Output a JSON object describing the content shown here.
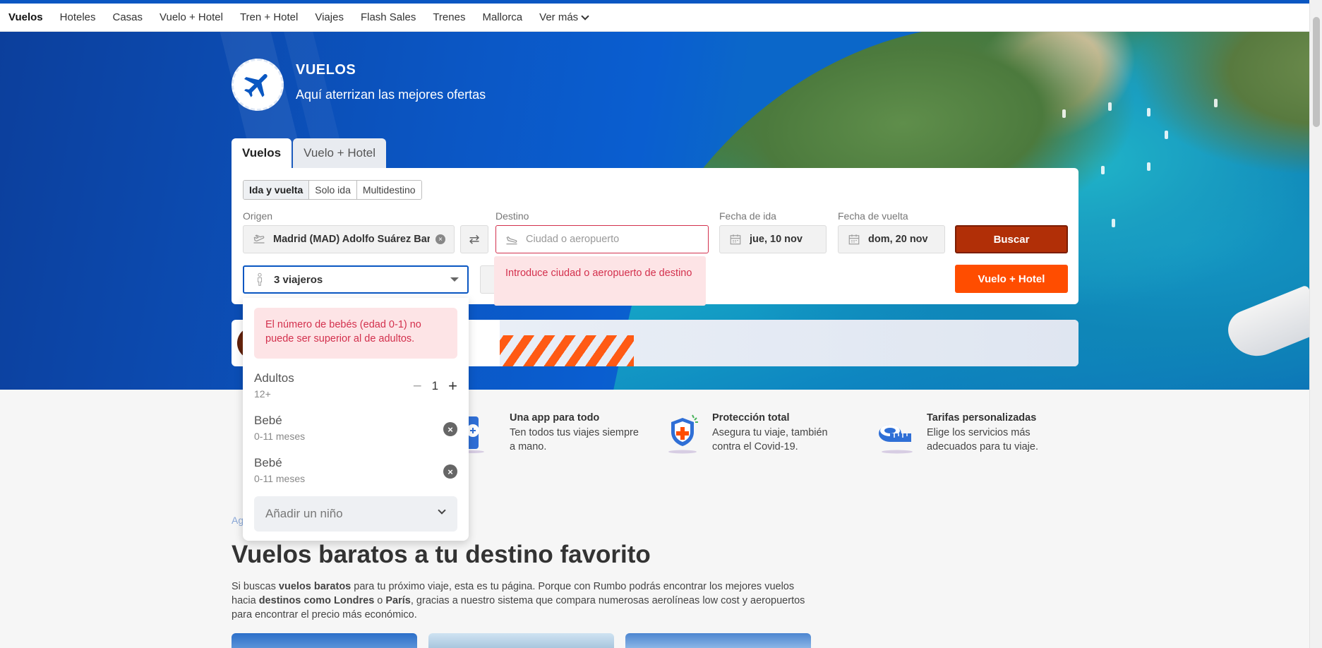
{
  "nav": {
    "items": [
      "Vuelos",
      "Hoteles",
      "Casas",
      "Vuelo + Hotel",
      "Tren + Hotel",
      "Viajes",
      "Flash Sales",
      "Trenes",
      "Mallorca"
    ],
    "more": "Ver más"
  },
  "hero": {
    "title": "VUELOS",
    "subtitle": "Aquí aterrizan las mejores ofertas"
  },
  "search": {
    "tabs": [
      "Vuelos",
      "Vuelo + Hotel"
    ],
    "trip_types": [
      "Ida y vuelta",
      "Solo ida",
      "Multidestino"
    ],
    "origin_label": "Origen",
    "origin_value": "Madrid (MAD) Adolfo Suárez Barajas",
    "destination_label": "Destino",
    "destination_placeholder": "Ciudad o aeropuerto",
    "depart_label": "Fecha de ida",
    "depart_value": "jue, 10 nov",
    "return_label": "Fecha de vuelta",
    "return_value": "dom, 20 nov",
    "search_button": "Buscar",
    "flight_hotel_button": "Vuelo + Hotel",
    "travelers_value": "3 viajeros",
    "destination_error": "Introduce ciudad o aeropuerto de destino"
  },
  "travelers_dropdown": {
    "error": "El número de bebés (edad 0-1) no puede ser superior al de adultos.",
    "adults_label": "Adultos",
    "adults_sub": "12+",
    "adults_count": "1",
    "infants": [
      {
        "label": "Bebé",
        "sub": "0-11 meses"
      },
      {
        "label": "Bebé",
        "sub": "0-11 meses"
      }
    ],
    "add_child": "Añadir un niño"
  },
  "features": [
    {
      "title": "Una app para todo",
      "text": "Ten todos tus viajes siempre a mano."
    },
    {
      "title": "Protección total",
      "text": "Asegura tu viaje, también contra el Covid-19."
    },
    {
      "title": "Tarifas personalizadas",
      "text": "Elige los servicios más adecuados para tu viaje."
    }
  ],
  "content": {
    "breadcrumb": "Ag",
    "heading": "Vuelos baratos a tu destino favorito",
    "paragraph_parts": [
      "Si buscas ",
      "vuelos baratos",
      " para tu próximo viaje, esta es tu página. Porque con Rumbo podrás encontrar los mejores vuelos hacia ",
      "destinos como Londres",
      " o ",
      "París",
      ", gracias a nuestro sistema que compara numerosas aerolíneas low cost y aeropuertos para encontrar el precio más económico."
    ]
  },
  "colors": {
    "brand_blue": "#0a57c2",
    "search_button": "#b12f07",
    "cta_orange": "#ff4d00",
    "error_red": "#d3304d",
    "error_bg": "#fde4e6"
  }
}
